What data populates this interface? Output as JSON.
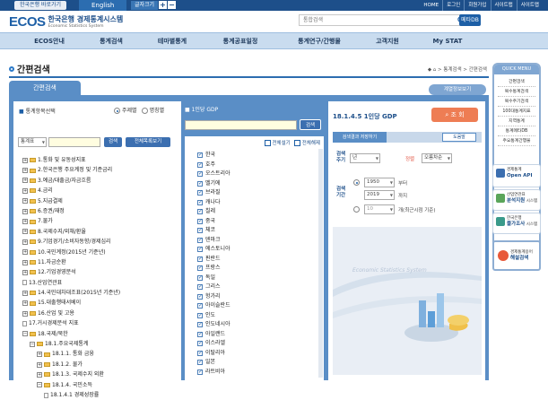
{
  "topbar": {
    "bok_link": "한국은행 바로가기",
    "lang": "English",
    "text_size": "글자크기",
    "zoom_in": "+",
    "zoom_out": "−",
    "links": [
      "HOME",
      "로그인",
      "회원가입",
      "사이트맵",
      "사이트맵"
    ]
  },
  "header": {
    "logo_mark": "ECOS",
    "logo_korean": "한국은행 경제통계시스템",
    "logo_english": "Economic Statistics System",
    "search_placeholder": "통합검색",
    "etc_button": "메타DB"
  },
  "gnb": [
    "ECOS안내",
    "통계검색",
    "테마별통계",
    "통계공표일정",
    "통계연구/간행물",
    "고객지원",
    "My STAT"
  ],
  "page": {
    "title": "간편검색",
    "breadcrumb": "◆ ⌂ > 통계검색 > 간편검색",
    "tab_active": "간편검색",
    "tab_right": "계열정보보기"
  },
  "left_panel": {
    "header": "통계항목선택",
    "radio_theme": "주제별",
    "radio_name": "명칭별",
    "select_value": "통계표",
    "search_button": "검색",
    "alpha_button": "전체목록보기",
    "tree": [
      {
        "level": 0,
        "type": "plus",
        "label": "1.통화 및 유동성지표"
      },
      {
        "level": 0,
        "type": "plus",
        "label": "2.한국은행 주요계정 및 기준금리"
      },
      {
        "level": 0,
        "type": "plus",
        "label": "3.예금/대출금/자금흐름"
      },
      {
        "level": 0,
        "type": "plus",
        "label": "4.금리"
      },
      {
        "level": 0,
        "type": "plus",
        "label": "5.지급결제"
      },
      {
        "level": 0,
        "type": "plus",
        "label": "6.증권/재정"
      },
      {
        "level": 0,
        "type": "plus",
        "label": "7.물가"
      },
      {
        "level": 0,
        "type": "plus",
        "label": "8.국제수지/외채/환율"
      },
      {
        "level": 0,
        "type": "plus",
        "label": "9.기업경기/소비자동향/경제심리"
      },
      {
        "level": 0,
        "type": "plus",
        "label": "10.국민계정(2015년 기준년)"
      },
      {
        "level": 0,
        "type": "plus",
        "label": "11.자금순환"
      },
      {
        "level": 0,
        "type": "plus",
        "label": "12.기업경영분석"
      },
      {
        "level": 0,
        "type": "doc",
        "label": "13.산업연관표"
      },
      {
        "level": 0,
        "type": "plus",
        "label": "14.국민대차대조표(2015년 기준년)"
      },
      {
        "level": 0,
        "type": "plus",
        "label": "15.대출행태서베이"
      },
      {
        "level": 0,
        "type": "plus",
        "label": "16.산업 및 고용"
      },
      {
        "level": 0,
        "type": "doc",
        "label": "17.거시경제분석 지표"
      },
      {
        "level": 0,
        "type": "minus",
        "label": "18.국제/북한"
      },
      {
        "level": 1,
        "type": "minus",
        "label": "18.1.주요국제통계"
      },
      {
        "level": 2,
        "type": "plus",
        "label": "18.1.1. 통화 금융"
      },
      {
        "level": 2,
        "type": "plus",
        "label": "18.1.2. 물가"
      },
      {
        "level": 2,
        "type": "plus",
        "label": "18.1.3. 국제수지 외환"
      },
      {
        "level": 2,
        "type": "minus",
        "label": "18.1.4. 국민소득"
      },
      {
        "level": 3,
        "type": "doc",
        "label": "18.1.4.1 경제성장률"
      }
    ]
  },
  "mid_panel": {
    "label": "1인당 GDP",
    "query_button": "검색",
    "select_all": "전체설기",
    "deselect_all": "전체해제",
    "countries": [
      "한국",
      "호주",
      "오스트리아",
      "벨기에",
      "브라질",
      "캐나다",
      "칠레",
      "중국",
      "체코",
      "덴마크",
      "에스토니아",
      "핀란드",
      "프랑스",
      "독일",
      "그리스",
      "헝가리",
      "아이슬란드",
      "인도",
      "인도네시아",
      "아일랜드",
      "이스라엘",
      "이탈리아",
      "일본",
      "라트비아"
    ]
  },
  "right_panel": {
    "stat_title": "18.1.4.5 1인당 GDP",
    "view_button": "조 회",
    "bar_left": "검색결과 저장하기",
    "bar_right": "도움말",
    "cycle_label": "검색주기",
    "cycle_value": "년",
    "unit_label": "정렬",
    "order_value": "오름차순",
    "period_label": "검색기간",
    "from_value": "1950",
    "from_suffix": "부터",
    "to_value": "2019",
    "to_suffix": "까지",
    "recent_value": "10",
    "recent_suffix": "개(최근시점 기준)",
    "deco_text": "Economic Statistics System"
  },
  "quick_menu": {
    "title": "QUICK MENU",
    "items": [
      "간편검색",
      "복수통계검색",
      "복수주기검색",
      "100대통계지표",
      "지역통계",
      "통계메타DB",
      "주요통계간행물"
    ]
  },
  "side_banners": [
    {
      "lines": [
        "경제통계",
        "Open API"
      ]
    },
    {
      "lines": [
        "산업연관표",
        "분석지원",
        "시스템"
      ]
    },
    {
      "lines": [
        "한국은행",
        "물가조사",
        "시스템"
      ]
    },
    {
      "lines": [
        "경제통계용어",
        "해설검색"
      ]
    }
  ],
  "colors": {
    "brand": "#1d4f8a",
    "accent": "#ee7d54",
    "panel": "#5a8ec6"
  }
}
